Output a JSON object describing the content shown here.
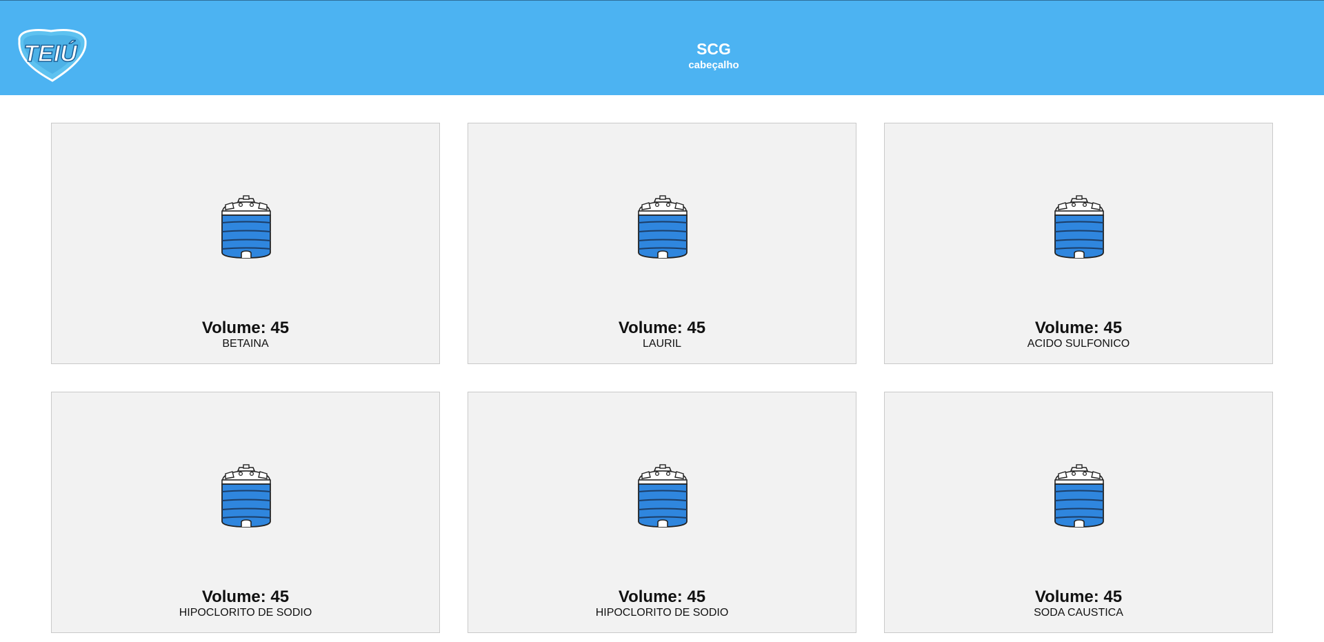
{
  "header": {
    "title": "SCG",
    "subtitle": "cabeçalho",
    "logo_text": "TEIÚ",
    "background_color": "#4cb3f2"
  },
  "cards": [
    {
      "volume_label": "Volume: 45",
      "name": "BETAINA",
      "icon": "water-tank-icon"
    },
    {
      "volume_label": "Volume: 45",
      "name": "LAURIL",
      "icon": "water-tank-icon"
    },
    {
      "volume_label": "Volume: 45",
      "name": "ACIDO SULFONICO",
      "icon": "water-tank-icon"
    },
    {
      "volume_label": "Volume: 45",
      "name": "HIPOCLORITO DE SODIO",
      "icon": "water-tank-icon"
    },
    {
      "volume_label": "Volume: 45",
      "name": "HIPOCLORITO DE SODIO",
      "icon": "water-tank-icon"
    },
    {
      "volume_label": "Volume: 45",
      "name": "SODA CAUSTICA",
      "icon": "water-tank-icon"
    }
  ],
  "colors": {
    "card_background": "#f2f2f2",
    "tank_fill": "#2f86de"
  }
}
